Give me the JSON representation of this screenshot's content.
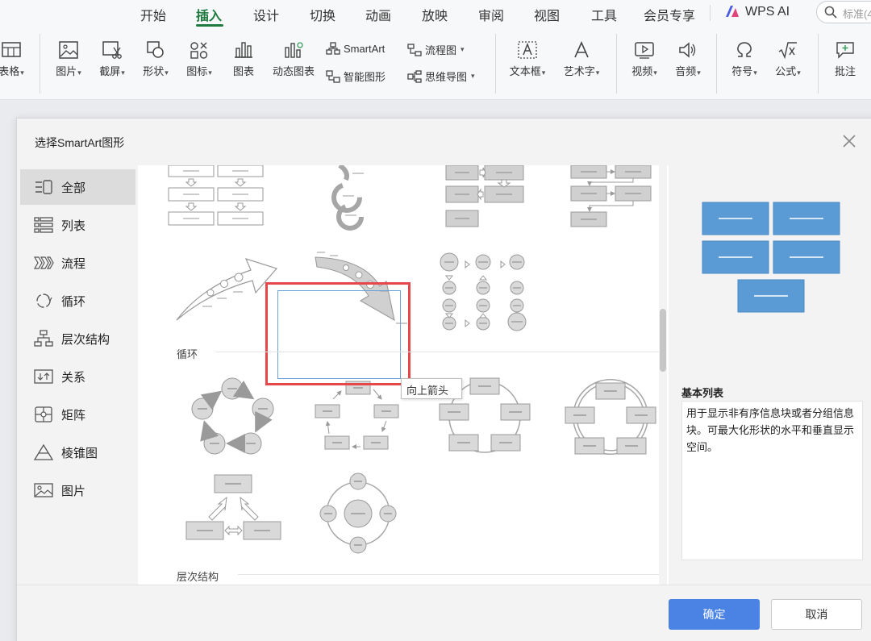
{
  "menu": {
    "tabs": [
      "开始",
      "插入",
      "设计",
      "切换",
      "动画",
      "放映",
      "审阅",
      "视图",
      "工具",
      "会员专享",
      "WPS AI"
    ],
    "active_tab": "插入",
    "search_placeholder": "标准(4"
  },
  "ribbon": {
    "table": "表格",
    "picture": "图片",
    "screenshot": "截屏",
    "shape": "形状",
    "icon": "图标",
    "chart": "图表",
    "dynamic_chart": "动态图表",
    "smartart": "SmartArt",
    "smart_graphic": "智能图形",
    "flowchart": "流程图",
    "mindmap": "思维导图",
    "textbox": "文本框",
    "wordart": "艺术字",
    "video": "视频",
    "audio": "音频",
    "symbol": "符号",
    "formula": "公式",
    "comment": "批注"
  },
  "dialog": {
    "title": "选择SmartArt图形",
    "categories": [
      {
        "label": "全部",
        "icon": "all-icon"
      },
      {
        "label": "列表",
        "icon": "list-icon"
      },
      {
        "label": "流程",
        "icon": "process-icon"
      },
      {
        "label": "循环",
        "icon": "cycle-icon"
      },
      {
        "label": "层次结构",
        "icon": "hierarchy-icon"
      },
      {
        "label": "关系",
        "icon": "relationship-icon"
      },
      {
        "label": "矩阵",
        "icon": "matrix-icon"
      },
      {
        "label": "棱锥图",
        "icon": "pyramid-icon"
      },
      {
        "label": "图片",
        "icon": "picture-icon"
      }
    ],
    "selected_category": "全部",
    "sections": {
      "cycle": "循环",
      "hierarchy": "层次结构"
    },
    "tooltip": "向上箭头",
    "preview": {
      "name": "基本列表",
      "description": "用于显示非有序信息块或者分组信息块。可最大化形状的水平和垂直显示空间。"
    },
    "ok": "确定",
    "cancel": "取消"
  },
  "colors": {
    "accent_green": "#1f7a3f",
    "primary_blue": "#4a83e4",
    "preview_blue": "#5b9bd5",
    "highlight_red": "#e5474b"
  }
}
